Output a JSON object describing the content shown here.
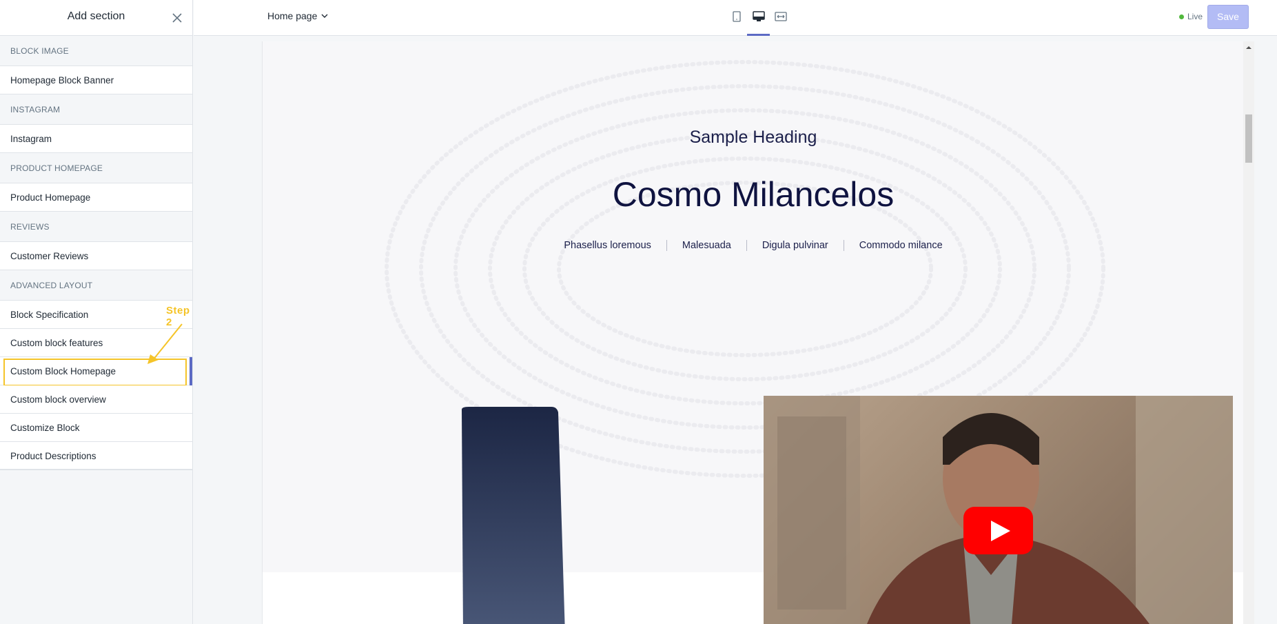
{
  "sidebar": {
    "title": "Add section",
    "categories": [
      {
        "label": "BLOCK IMAGE",
        "items": [
          {
            "label": "Homepage Block Banner"
          }
        ]
      },
      {
        "label": "INSTAGRAM",
        "items": [
          {
            "label": "Instagram"
          }
        ]
      },
      {
        "label": "PRODUCT HOMEPAGE",
        "items": [
          {
            "label": "Product Homepage"
          }
        ]
      },
      {
        "label": "REVIEWS",
        "items": [
          {
            "label": "Customer Reviews"
          }
        ]
      },
      {
        "label": "ADVANCED LAYOUT",
        "items": [
          {
            "label": "Block Specification"
          },
          {
            "label": "Custom block features"
          },
          {
            "label": "Custom Block Homepage"
          },
          {
            "label": "Custom block overview"
          },
          {
            "label": "Customize Block"
          },
          {
            "label": "Product Descriptions"
          }
        ]
      }
    ],
    "annotation": "Step 2"
  },
  "topbar": {
    "page_select": "Home page",
    "devices": [
      {
        "icon": "mobile-icon"
      },
      {
        "icon": "desktop-icon",
        "active": true
      },
      {
        "icon": "fullwidth-icon"
      }
    ],
    "status": "Live",
    "save_label": "Save"
  },
  "preview": {
    "sample_heading": "Sample Heading",
    "title": "Cosmo Milancelos",
    "links": [
      "Phasellus loremous",
      "Malesuada",
      "Digula pulvinar",
      "Commodo milance"
    ]
  },
  "colors": {
    "accent": "#5c6ac4",
    "annotation": "#f5c428",
    "live": "#50b83c",
    "save_disabled": "#b3bcf5",
    "youtube_red": "#ff0000"
  }
}
